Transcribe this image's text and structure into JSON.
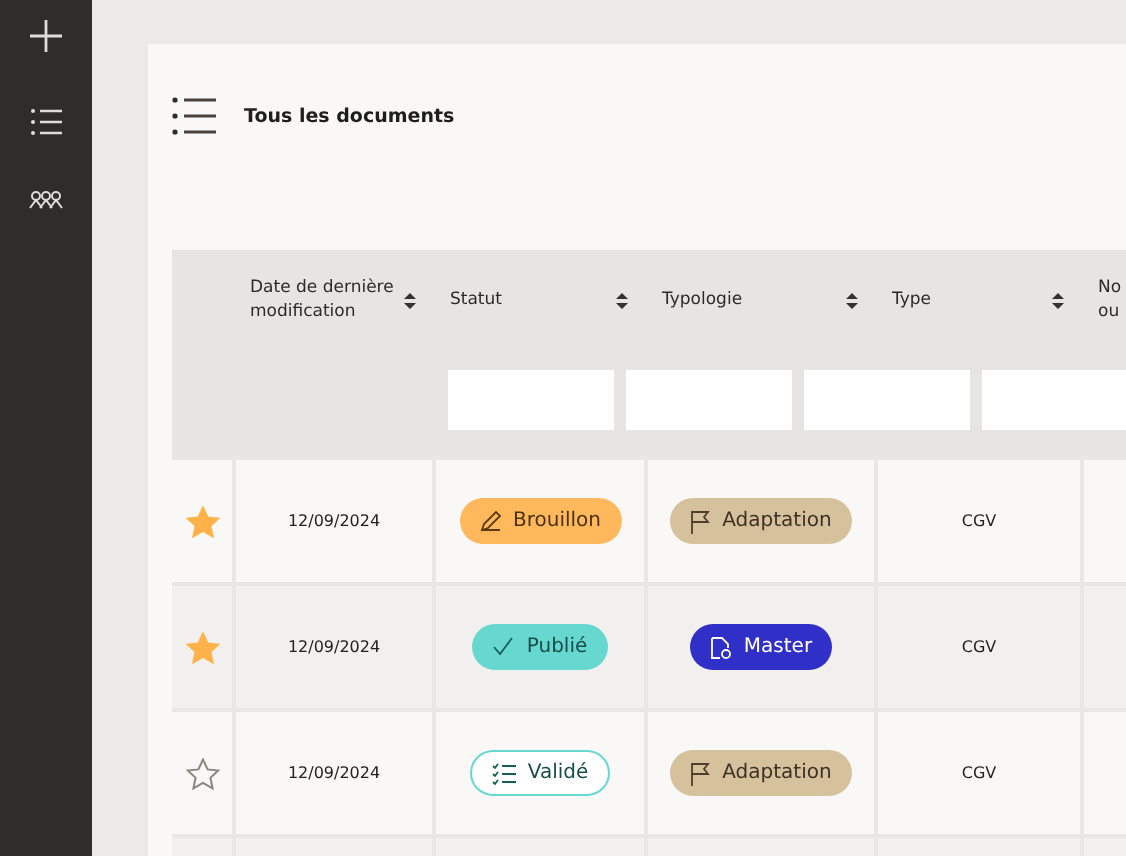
{
  "title": "Tous les documents",
  "columns": [
    {
      "label": "Date de dernière modification",
      "sortable": true
    },
    {
      "label": "Statut",
      "sortable": true
    },
    {
      "label": "Typologie",
      "sortable": true
    },
    {
      "label": "Type",
      "sortable": true
    },
    {
      "label": "No\nou"
    }
  ],
  "rows": [
    {
      "starred": true,
      "date": "12/09/2024",
      "status": {
        "kind": "draft",
        "label": "Brouillon"
      },
      "typology": {
        "kind": "adaptation",
        "label": "Adaptation"
      },
      "type": "CGV"
    },
    {
      "starred": true,
      "date": "12/09/2024",
      "status": {
        "kind": "published",
        "label": "Publié"
      },
      "typology": {
        "kind": "master",
        "label": "Master"
      },
      "type": "CGV"
    },
    {
      "starred": false,
      "date": "12/09/2024",
      "status": {
        "kind": "validated",
        "label": "Validé"
      },
      "typology": {
        "kind": "adaptation",
        "label": "Adaptation"
      },
      "type": "CGV"
    }
  ]
}
